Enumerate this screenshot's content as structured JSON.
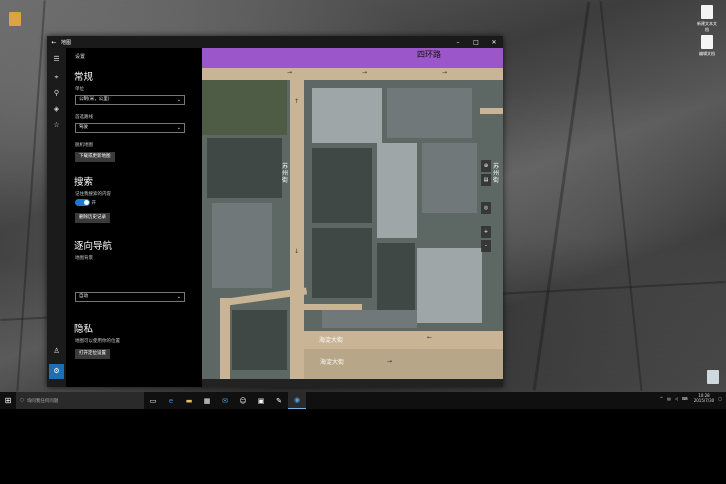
{
  "window": {
    "title": "地图"
  },
  "settings": {
    "header": "设置",
    "general": {
      "heading": "常规",
      "units_label": "单位",
      "units_value": "公制(米，公里)",
      "route_label": "首选路线",
      "route_value": "驾驶",
      "offline_label": "脱机地图",
      "offline_button": "下载或更新地图"
    },
    "search": {
      "heading": "搜索",
      "remember_label": "记住我搜索的内容",
      "toggle_state": "开",
      "clear_button": "删除历史记录"
    },
    "navigation": {
      "heading": "逐向导航",
      "background_label": "地图背景",
      "background_value": "自动"
    },
    "privacy": {
      "heading": "隐私",
      "location_label": "地图可以使用你的位置",
      "location_button": "打开定位设置"
    }
  },
  "map": {
    "road_main": "四环路",
    "road_south_1": "海淀大街",
    "road_south_2": "海淀大街",
    "vertical_street": "苏州街",
    "right_street": "苏州街",
    "tool_icons": [
      "compass-icon",
      "layers-icon",
      "locate-icon",
      "zoom-in-icon",
      "zoom-out-icon"
    ]
  },
  "taskbar": {
    "search_placeholder": "询问我任何问题",
    "apps": [
      "task-view-icon",
      "edge-icon",
      "file-explorer-icon",
      "store-icon",
      "mail-icon",
      "people-icon",
      "photos-icon",
      "paint-icon",
      "maps-icon"
    ],
    "time": "10:28",
    "date": "2015/7/30"
  },
  "desktop": {
    "icons": [
      "新建文本文档",
      "编辑文档"
    ]
  },
  "colors": {
    "accent": "#1e78d2",
    "purple_road": "#9b57c9",
    "road": "#c9b596"
  }
}
